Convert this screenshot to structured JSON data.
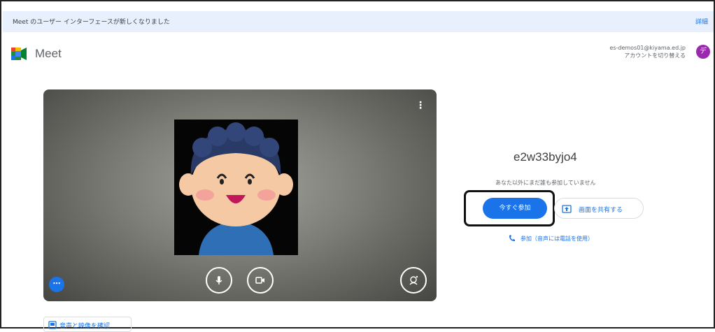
{
  "banner": {
    "text": "Meet のユーザー インターフェースが新しくなりました",
    "link": "詳細"
  },
  "header": {
    "brand": "Meet",
    "account_email": "es-demos01@kiyama.ed.jp",
    "switch_account": "アカウントを切り替える",
    "avatar_initial": "デ"
  },
  "preview": {
    "menu_icon": "more-vert-icon"
  },
  "meeting": {
    "code": "e2w33byjo4",
    "status": "あなた以外にまだ誰も参加していません",
    "join_now": "今すぐ参加",
    "share_screen": "画面を共有する",
    "phone_join": "参加（音声には電話を使用）"
  },
  "footer": {
    "check_av": "音声と映像を確認"
  },
  "colors": {
    "accent": "#1a73e8",
    "banner_bg": "#e8f0fe",
    "avatar": "#9c27b0"
  }
}
